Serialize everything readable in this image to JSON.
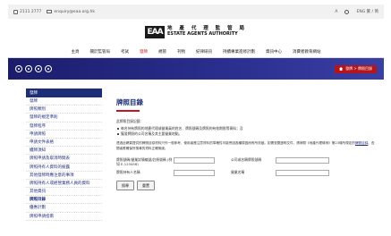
{
  "topbar": {
    "phone": "2111 2777",
    "email": "enquiry@eaa.org.hk",
    "lang": "ENG 繁 / 简",
    "text_size": "A"
  },
  "header": {
    "logo_mark": "EAA",
    "logo_zh": "地 產 代 理 監 管 局",
    "logo_en": "ESTATE AGENTS AUTHORITY"
  },
  "nav": {
    "items": [
      "主頁",
      "關於監管局",
      "考試",
      "發牌",
      "規管",
      "刊物",
      "紀律研訊",
      "持續專業進修計劃",
      "資訊中心",
      "消費者教育網站"
    ]
  },
  "banner": {
    "breadcrumb": "發牌 > 牌照目錄"
  },
  "sidebar": {
    "heading": "發牌",
    "items": [
      "發牌",
      "牌照類別",
      "發牌的規定準則",
      "發牌程序",
      "申請牌照",
      "申請文件表格",
      "續牌須知",
      "牌照申請及取消時間表",
      "牌照持有人資料的披露",
      "其他發牌時應注意的事項",
      "牌照持有人或經營業務人員的資料",
      "其他資訊",
      "牌照目錄",
      "優惠計劃",
      "牌照申請指南"
    ],
    "active_index": 12
  },
  "main": {
    "title": "牌照目錄",
    "intro": "此牌照目錄記載：",
    "bullets": [
      "每名持有牌照的地產代理或營業員的姓名、牌照號碼及牌照的有效期限等資料；及",
      "獲發牌照的公司名稱及其主要營業地點。"
    ],
    "note": "透過此網頁提供的牌照目錄資料只作一般參考，使用者應注意資料的準確性可能會因各種原因而有所改變。如需查閱證明文件，請參閱《地產代理條例》第23條所規定的",
    "note_link": "牌照目錄",
    "note_tail": "。查閱者應確保所搜尋的資料正確無誤。",
    "form": {
      "license_label": "牌照號碼/營業詳情編號/註冊號碼 (例如 E-123456)",
      "holder_label": "牌照持有人名稱",
      "company_license_label": "公司或名稱牌照號碼",
      "company_name_label": "營業名稱",
      "search_button": "搜尋",
      "reset_button": "重置"
    }
  }
}
